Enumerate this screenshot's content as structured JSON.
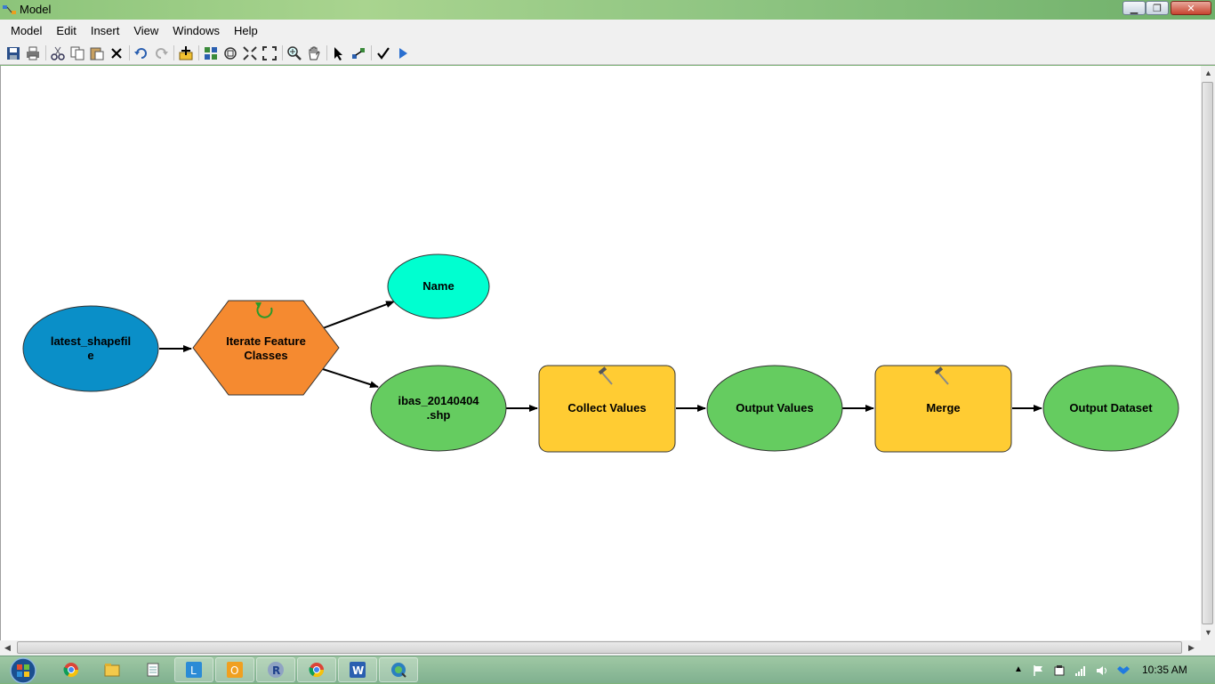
{
  "window": {
    "title": "Model"
  },
  "menu": [
    "Model",
    "Edit",
    "Insert",
    "View",
    "Windows",
    "Help"
  ],
  "toolbar": [
    "save-icon",
    "print-icon",
    "cut-icon",
    "copy-icon",
    "paste-icon",
    "delete-icon",
    "undo-icon",
    "redo-icon",
    "add-data-icon",
    "auto-layout-icon",
    "full-extent-icon",
    "fixed-zoom-in-icon",
    "fixed-zoom-out-icon",
    "zoom-in-icon",
    "pan-icon",
    "select-icon",
    "connect-icon",
    "validate-icon",
    "run-icon"
  ],
  "model": {
    "nodes": {
      "latest_shapefile": {
        "line1": "latest_shapefil",
        "line2": "e",
        "color": "#0a8fc8"
      },
      "iterate": {
        "line1": "Iterate Feature",
        "line2": "Classes",
        "color": "#f58a30"
      },
      "name": {
        "label": "Name",
        "color": "#00ffd0"
      },
      "ibas": {
        "line1": "ibas_20140404",
        "line2": ".shp",
        "color": "#65cc60"
      },
      "collect": {
        "label": "Collect Values",
        "color": "#ffcc33"
      },
      "output_values": {
        "label": "Output Values",
        "color": "#65cc60"
      },
      "merge": {
        "label": "Merge",
        "color": "#ffcc33"
      },
      "output_dataset": {
        "label": "Output Dataset",
        "color": "#65cc60"
      }
    }
  },
  "taskbar": {
    "apps": [
      "chrome-icon",
      "explorer-icon",
      "notepad-icon",
      "lync-icon",
      "outlook-icon",
      "r-icon",
      "chrome-icon",
      "word-icon",
      "arcgis-icon"
    ],
    "clock": "10:35 AM"
  }
}
